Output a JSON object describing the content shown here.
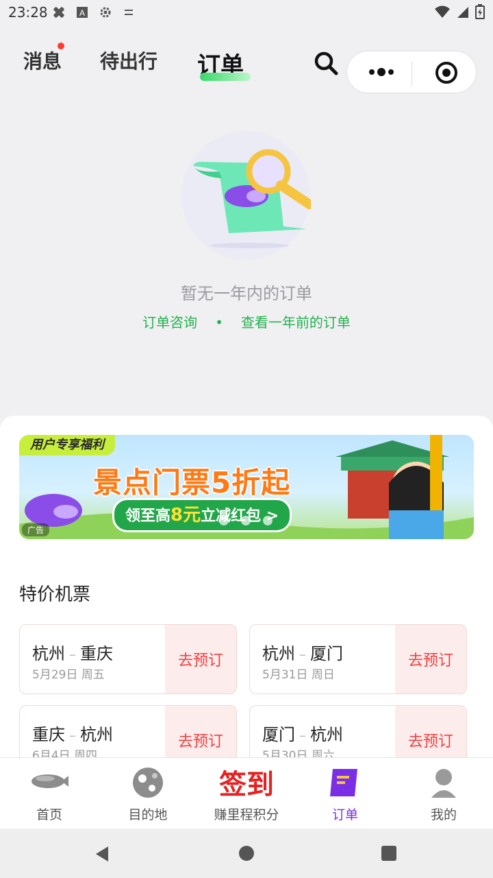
{
  "status": {
    "time": "23:28"
  },
  "topnav": {
    "tabs": [
      {
        "label": "消息",
        "has_dot": true
      },
      {
        "label": "待出行"
      },
      {
        "label": "订单",
        "active": true
      }
    ]
  },
  "empty": {
    "title": "暂无一年内的订单",
    "link_consult": "订单咨询",
    "bullet": "•",
    "link_older": "查看一年前的订单"
  },
  "banner": {
    "tag": "用户专享福利",
    "headline": "景点门票5折起",
    "pill_prefix": "领至高",
    "pill_amount": "8元",
    "pill_suffix": "立减红包 >",
    "ad_label": "广告"
  },
  "section": {
    "title": "特价机票"
  },
  "flights": [
    {
      "from": "杭州",
      "to": "重庆",
      "date": "5月29日 周五",
      "action": "去预订"
    },
    {
      "from": "杭州",
      "to": "厦门",
      "date": "5月31日 周日",
      "action": "去预订"
    },
    {
      "from": "重庆",
      "to": "杭州",
      "date": "6月4日 周四",
      "action": "去预订"
    },
    {
      "from": "厦门",
      "to": "杭州",
      "date": "5月30日 周六",
      "action": "去预订"
    }
  ],
  "bottom_nav": {
    "items": [
      {
        "label": "首页"
      },
      {
        "label": "目的地"
      },
      {
        "label": "赚里程积分",
        "badge": "签到"
      },
      {
        "label": "订单",
        "active": true
      },
      {
        "label": "我的"
      }
    ]
  },
  "colors": {
    "accent_green": "#22b14c",
    "active_purple": "#7a2ee6",
    "price_red": "#f04040"
  }
}
